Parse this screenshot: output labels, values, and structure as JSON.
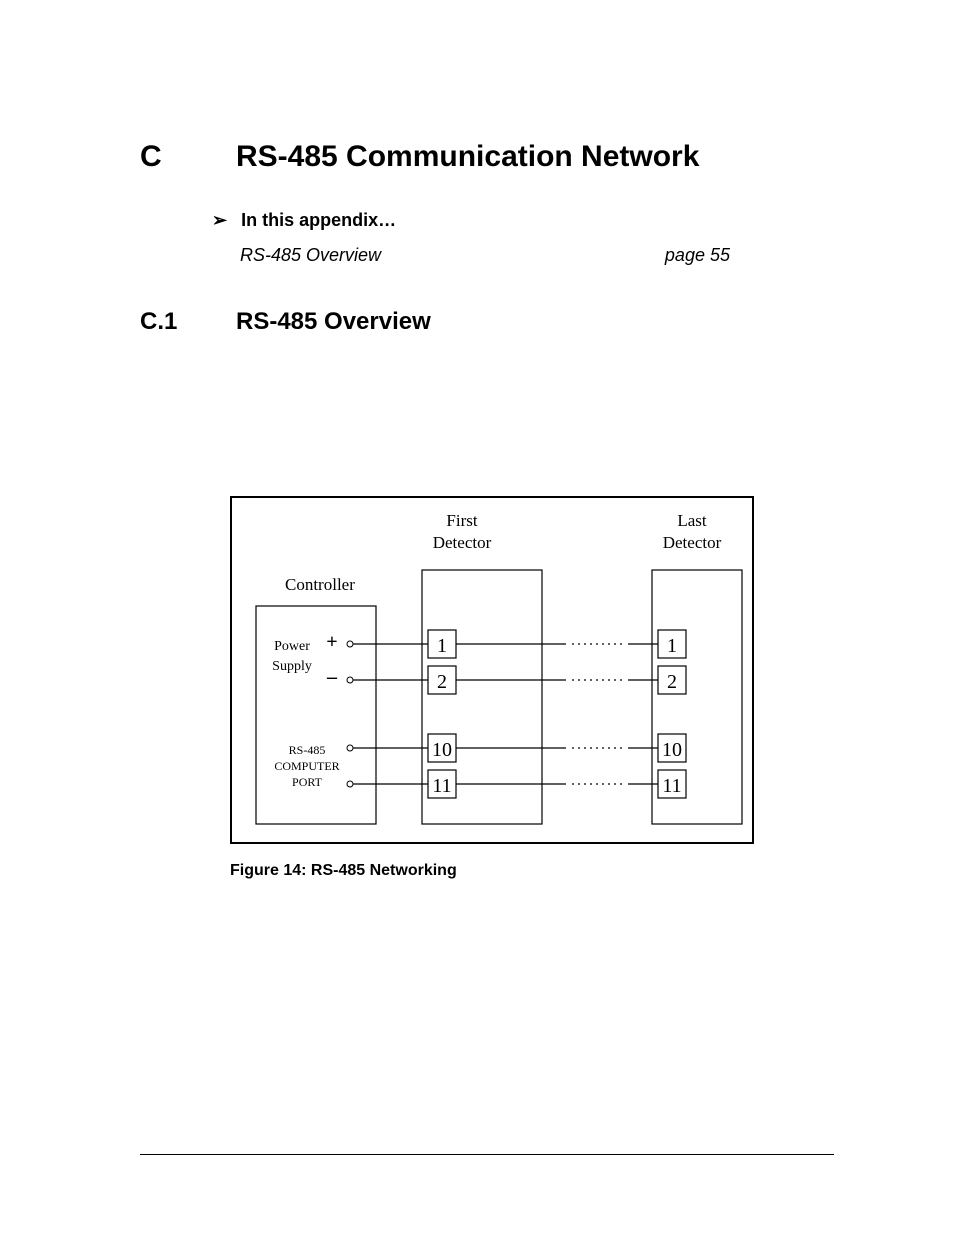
{
  "header": {
    "appendix_letter": "C",
    "appendix_title": "RS-485 Communication Network"
  },
  "bullet": {
    "glyph": "➢",
    "label": "In this appendix…"
  },
  "toc": {
    "item": "RS-485 Overview",
    "page": "page 55"
  },
  "section": {
    "number": "C.1",
    "title": "RS-485 Overview"
  },
  "figure": {
    "labels": {
      "controller": "Controller",
      "first_detector_top": "First",
      "first_detector_bottom": "Detector",
      "last_detector_top": "Last",
      "last_detector_bottom": "Detector",
      "power_top": "Power",
      "power_bottom": "Supply",
      "power_plus": "+",
      "power_minus": "–",
      "port_l1": "RS-485",
      "port_l2": "COMPUTER",
      "port_l3": "PORT"
    },
    "terminals": {
      "first": [
        "1",
        "2",
        "10",
        "11"
      ],
      "last": [
        "1",
        "2",
        "10",
        "11"
      ]
    },
    "caption": "Figure 14: RS-485 Networking"
  }
}
